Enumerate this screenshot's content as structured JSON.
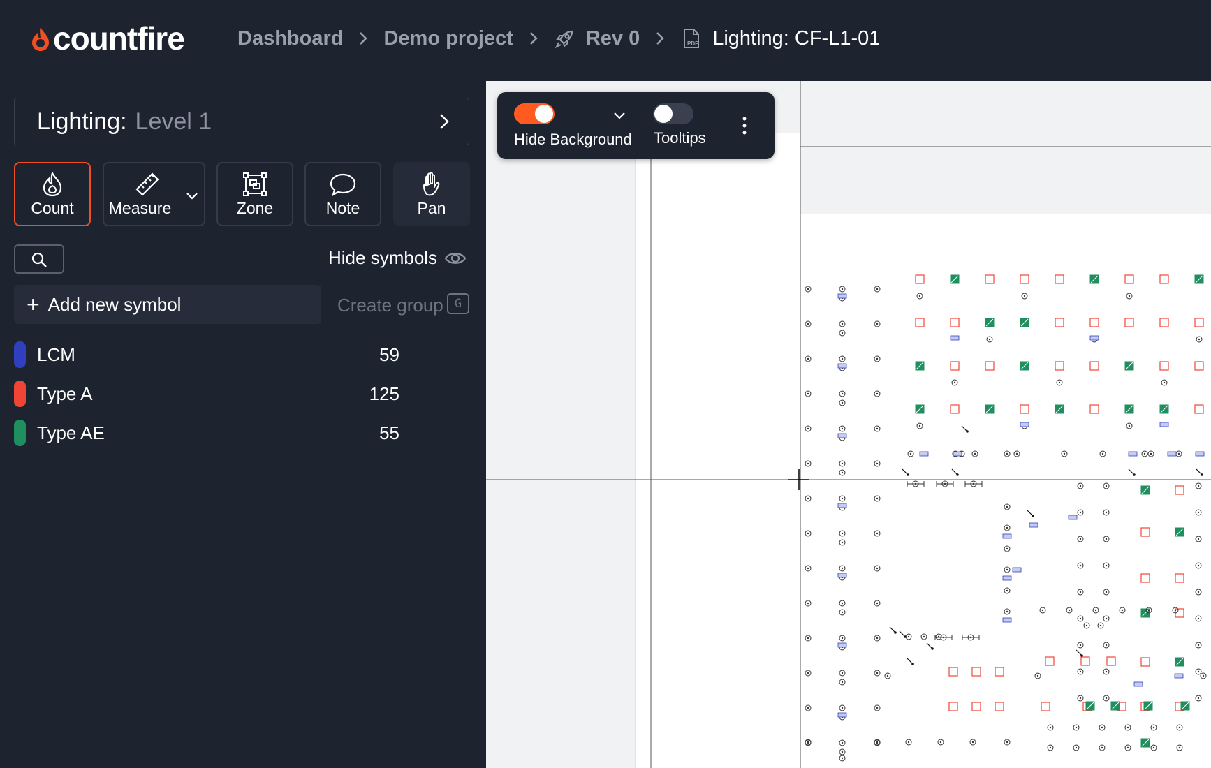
{
  "app": {
    "brand": "countfire",
    "accent": "#f04e23"
  },
  "breadcrumb": {
    "items": [
      "Dashboard",
      "Demo project",
      "Rev 0",
      "Lighting: CF-L1-01"
    ]
  },
  "selector": {
    "label": "Lighting:",
    "value": "Level 1"
  },
  "tools": {
    "count": "Count",
    "measure": "Measure",
    "zone": "Zone",
    "note": "Note",
    "pan": "Pan"
  },
  "symbols_header": {
    "hide_symbols": "Hide symbols",
    "add_new": "Add new symbol",
    "create_group": "Create group",
    "create_group_key": "G"
  },
  "symbols": [
    {
      "name": "LCM",
      "count": "59",
      "color": "#2f3fbf"
    },
    {
      "name": "Type A",
      "count": "125",
      "color": "#ef4535"
    },
    {
      "name": "Type AE",
      "count": "55",
      "color": "#1f8f5f"
    }
  ],
  "floating_toolbar": {
    "hide_background": "Hide Background",
    "hide_background_on": true,
    "tooltips": "Tooltips",
    "tooltips_on": false
  }
}
